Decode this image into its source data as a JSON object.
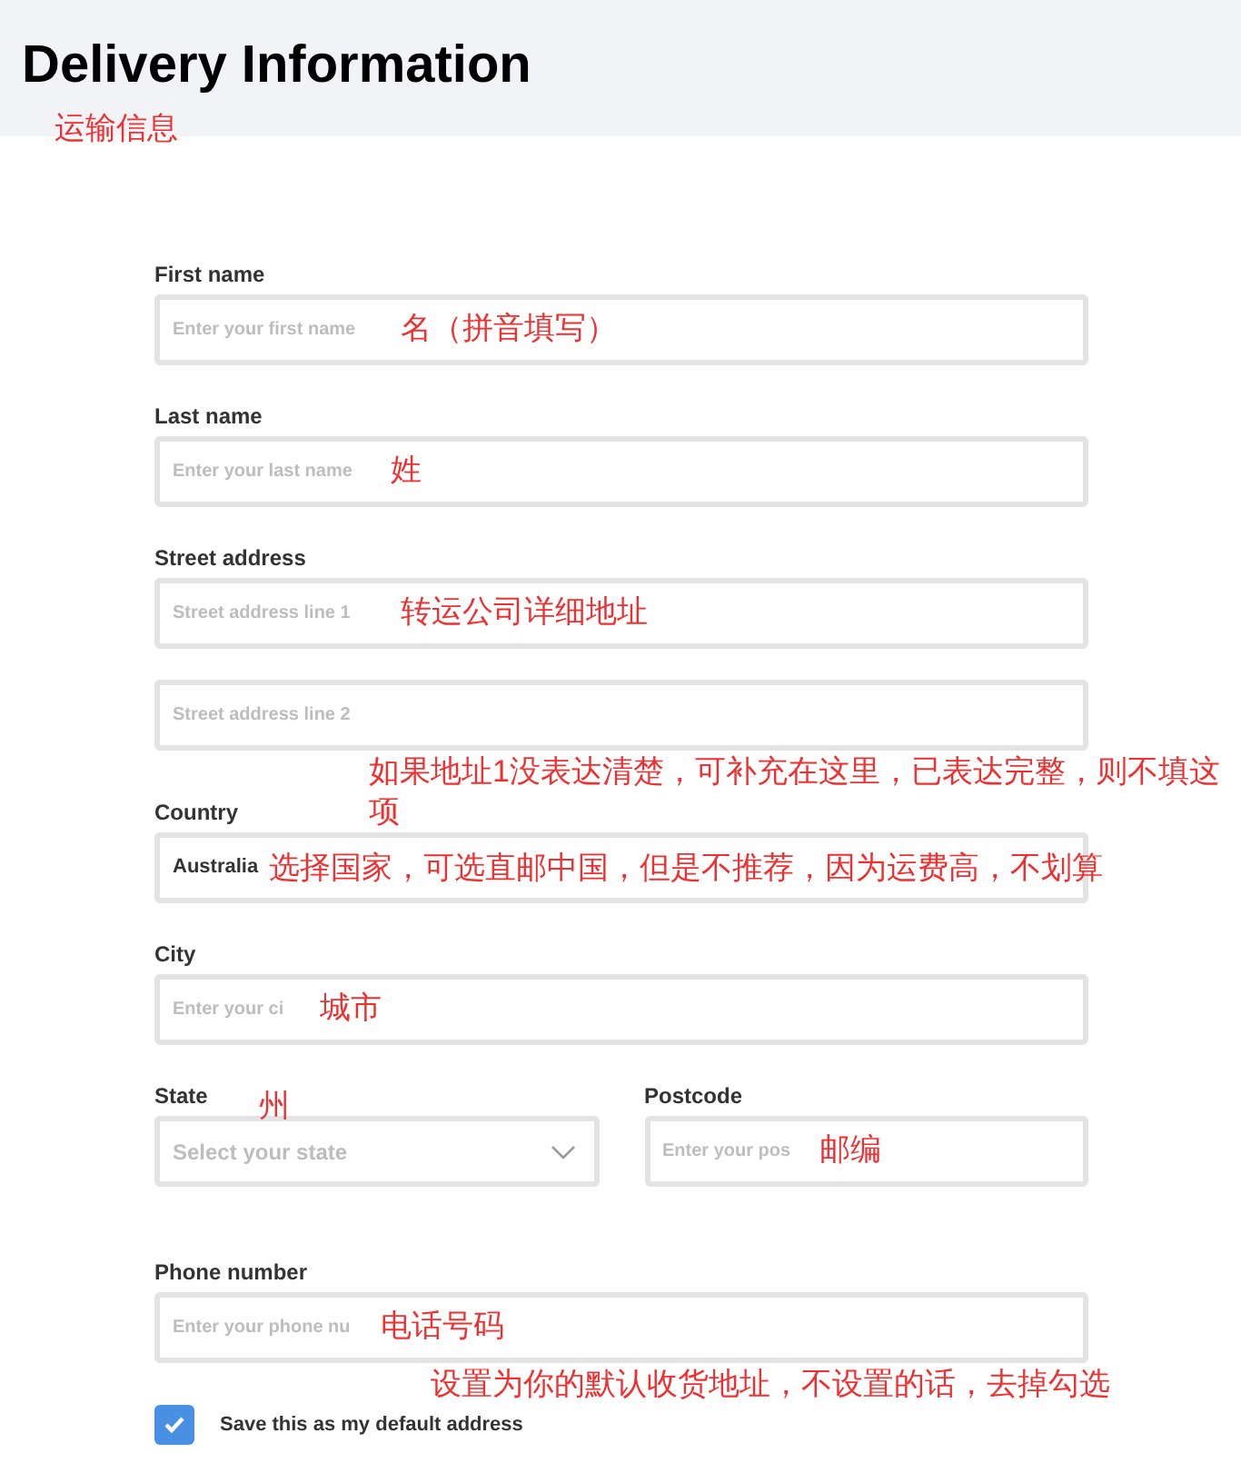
{
  "header": {
    "title": "Delivery Information",
    "note": "运输信息"
  },
  "rows": [
    {
      "fields": [
        {
          "kind": "input",
          "label": "First name",
          "placeholder": "Enter your first name",
          "note": "名（拼音填写）"
        }
      ]
    },
    {
      "fields": [
        {
          "kind": "input",
          "label": "Last name",
          "placeholder": "Enter your last name",
          "note": "姓"
        }
      ]
    },
    {
      "fields": [
        {
          "kind": "input",
          "label": "Street address",
          "placeholder": "Street address line 1",
          "note": "转运公司详细地址"
        }
      ]
    },
    {
      "fields": [
        {
          "kind": "input",
          "placeholder": "Street address line 2",
          "below_note": "如果地址1没表达清楚，可补充在这里，已表达完整，则不填这项"
        }
      ]
    },
    {
      "fields": [
        {
          "kind": "value",
          "label": "Country",
          "value": "Australia",
          "note": "选择国家，可选直邮中国，但是不推荐，因为运费高，不划算"
        }
      ]
    },
    {
      "fields": [
        {
          "kind": "input",
          "label": "City",
          "placeholder": "Enter your ci",
          "note": "城市"
        }
      ]
    },
    {
      "fields": [
        {
          "kind": "select",
          "label": "State",
          "placeholder": "Select your state",
          "label_note": "州"
        },
        {
          "kind": "input",
          "label": "Postcode",
          "placeholder": "Enter your pos",
          "note": "邮编"
        }
      ]
    },
    {
      "fields": [
        {
          "kind": "input",
          "label": "Phone number",
          "placeholder": "Enter your phone nu",
          "note": "电话号码"
        }
      ]
    }
  ],
  "default_address": {
    "label": "Save this as my default address",
    "checked": true,
    "note": "设置为你的默认收货地址，不设置的话，去掉勾选"
  }
}
